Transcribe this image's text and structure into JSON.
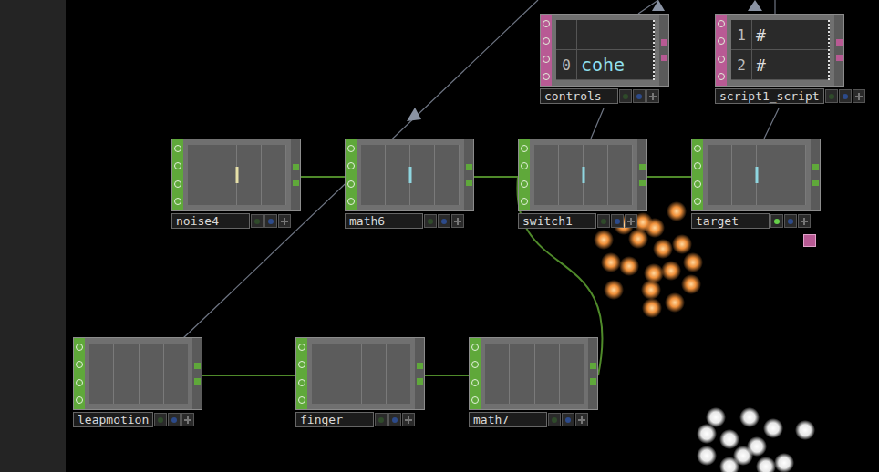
{
  "network": {
    "nodes": [
      {
        "name": "noise4",
        "kind": "chop",
        "color": "#e6e0a8",
        "viewer_active": false,
        "exported": false
      },
      {
        "name": "math6",
        "kind": "chop",
        "color": "#8fd6e0",
        "viewer_active": false,
        "exported": false
      },
      {
        "name": "switch1",
        "kind": "chop",
        "color": "#8fd6e0",
        "viewer_active": false,
        "exported": false
      },
      {
        "name": "target",
        "kind": "chop",
        "color": "#8fd6e0",
        "viewer_active": true,
        "exported": true
      },
      {
        "name": "leapmotion",
        "kind": "chop",
        "color": "",
        "viewer_active": false,
        "exported": false
      },
      {
        "name": "finger",
        "kind": "chop",
        "color": "",
        "viewer_active": false,
        "exported": false
      },
      {
        "name": "math7",
        "kind": "chop",
        "color": "",
        "viewer_active": false,
        "exported": false
      },
      {
        "name": "controls",
        "kind": "dat",
        "rows": [
          [
            "",
            ""
          ],
          [
            "0",
            "cohe"
          ]
        ],
        "viewer_active": false,
        "exported": false
      },
      {
        "name": "script1_script",
        "kind": "dat",
        "rows": [
          [
            "1",
            "#"
          ],
          [
            "2",
            "#"
          ]
        ],
        "viewer_active": false,
        "exported": false
      }
    ],
    "wires": [
      {
        "from": "noise4",
        "to": "math6"
      },
      {
        "from": "math6",
        "to": "switch1"
      },
      {
        "from": "switch1",
        "to": "target"
      },
      {
        "from": "leapmotion",
        "to": "finger"
      },
      {
        "from": "finger",
        "to": "math7"
      },
      {
        "from": "math7",
        "to": "switch1"
      }
    ],
    "references": [
      {
        "from": "switch1",
        "to": "controls"
      },
      {
        "from": "target",
        "to": "script1_script"
      }
    ]
  }
}
